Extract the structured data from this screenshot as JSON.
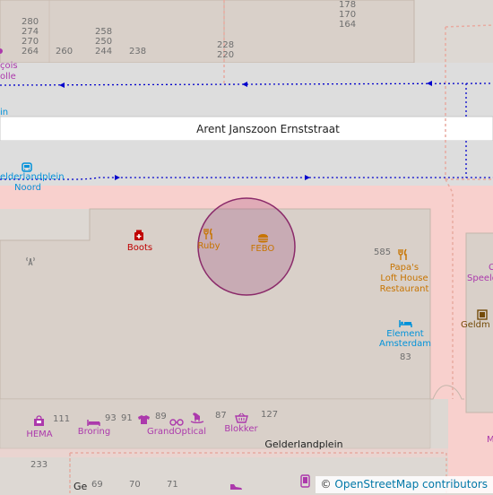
{
  "map": {
    "streets": {
      "main": "Arent Janszoon Ernststraat",
      "bottom": "Gelderlandplein",
      "cut_label": "Ge"
    },
    "bus_stop": {
      "line1": "elderlandplein",
      "line2": "Noord"
    },
    "left_cut_labels": {
      "poi_cut1": "çois",
      "poi_cut2": "olle",
      "cut_in": "in"
    },
    "right_cut_labels": {
      "r1": "C",
      "r2": "Speelg",
      "r3": "Geldm",
      "r4": "M"
    },
    "house_numbers": {
      "n280": "280",
      "n274": "274",
      "n270": "270",
      "n264": "264",
      "n260": "260",
      "n258": "258",
      "n250": "250",
      "n244": "244",
      "n238": "238",
      "n228": "228",
      "n220": "220",
      "n178": "178",
      "n170": "170",
      "n164": "164",
      "n585": "585",
      "n83": "83",
      "n111": "111",
      "n93": "93",
      "n91": "91",
      "n89": "89",
      "n87": "87",
      "n127": "127",
      "n233": "233",
      "n69": "69",
      "n70": "70",
      "n71": "71"
    },
    "pois": {
      "boots": "Boots",
      "ruby": "Ruby",
      "febo": "FEBO",
      "papas_l1": "Papa's",
      "papas_l2": "Loft House",
      "papas_l3": "Restaurant",
      "element_l1": "Element",
      "element_l2": "Amsterdam",
      "hema": "HEMA",
      "broring": "Broring",
      "grandoptical": "GrandOptical",
      "blokker": "Blokker"
    },
    "icons": {
      "boots": "pharmacy-icon",
      "ruby": "restaurant-icon",
      "febo": "fast-food-icon",
      "papas": "restaurant-icon",
      "element": "hotel-icon",
      "hema": "shop-icon",
      "broring": "bed-icon",
      "clothes": "clothes-icon",
      "optician": "glasses-icon",
      "toys": "toy-horse-icon",
      "blokker": "basket-icon",
      "bus": "bus-stop-icon",
      "mast": "communication-tower-icon",
      "shoes": "shoe-icon",
      "mobile": "mobile-shop-icon",
      "museum": "gallery-icon"
    },
    "colors": {
      "building": "#d9d0c9",
      "pedestrian": "#f8d0cd",
      "road": "#ffffff",
      "background": "#ddd8d3",
      "food": "#c77400",
      "shop": "#ac39ac",
      "health": "#bf0000",
      "tourism": "#0092da",
      "highlight": "#8b2a6a"
    },
    "highlight_circle": {
      "meaning": "selected location",
      "fill": "rgba(139,42,106,0.22)",
      "stroke": "#8b2a6a"
    }
  },
  "attribution": {
    "prefix": "© ",
    "link": "OpenStreetMap contributors"
  }
}
